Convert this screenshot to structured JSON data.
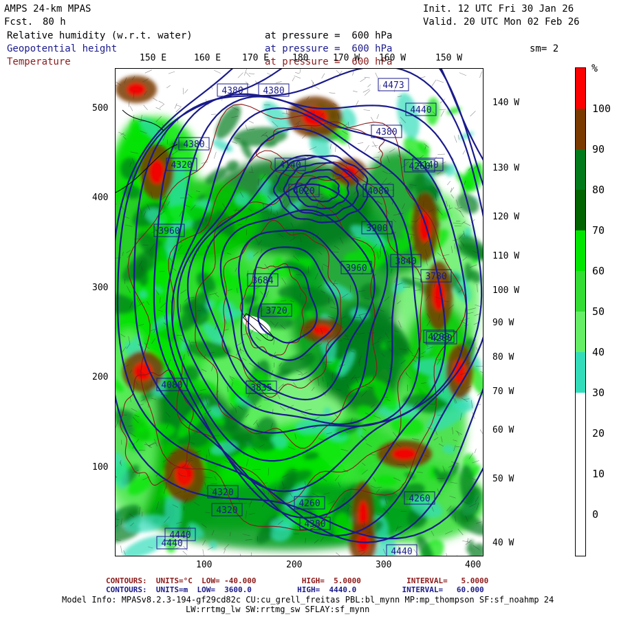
{
  "header": {
    "model": "AMPS 24-km MPAS",
    "fcst_label": "Fcst.",
    "fcst_value": "80 h",
    "init": "Init. 12 UTC Fri 30 Jan 26",
    "valid": "Valid. 20 UTC Mon 02 Feb 26",
    "smoothing": "sm= 2"
  },
  "fields": [
    {
      "name": "Relative humidity (w.r.t. water)",
      "level": "at pressure =  600 hPa",
      "color": "#000000"
    },
    {
      "name": "Geopotential height",
      "level": "at pressure =  600 hPa",
      "color": "#1a1a8c"
    },
    {
      "name": "Temperature",
      "level": "at pressure =  600 hPa",
      "color": "#8b1a1a"
    }
  ],
  "axes": {
    "top_labels": [
      "150 E",
      "160 E",
      "170 E",
      "180",
      "170 W",
      "160 W",
      "150 W"
    ],
    "right_labels": [
      "140 W",
      "130 W",
      "120 W",
      "110 W",
      "100 W",
      "90 W",
      "80 W",
      "70 W",
      "60 W",
      "50 W",
      "40 W"
    ],
    "left_ticks": [
      "500",
      "400",
      "300",
      "200",
      "100"
    ],
    "bottom_ticks": [
      "100",
      "200",
      "300",
      "400"
    ]
  },
  "colorbar": {
    "unit": "%",
    "labels": [
      "100",
      "90",
      "80",
      "70",
      "60",
      "50",
      "40",
      "30",
      "20",
      "10",
      "0"
    ],
    "segments": [
      {
        "range": "90-100+",
        "color": "#ff0000"
      },
      {
        "range": "90-100",
        "color": "#7a3a00"
      },
      {
        "range": "80-90",
        "color": "#007a1a"
      },
      {
        "range": "70-80",
        "color": "#006400"
      },
      {
        "range": "60-70",
        "color": "#00e600"
      },
      {
        "range": "50-60",
        "color": "#33dd33"
      },
      {
        "range": "40-50",
        "color": "#66ee66"
      },
      {
        "range": "30-40",
        "color": "#33ddbb"
      },
      {
        "range": "0-30",
        "color": "#ffffff"
      }
    ]
  },
  "contour_labels": [
    "4380",
    "4380",
    "4473",
    "4440",
    "4380",
    "4380",
    "4320",
    "4260",
    "4140",
    "4080",
    "4020",
    "3960",
    "3900",
    "3840",
    "3780",
    "3720",
    "3684",
    "3835",
    "4200",
    "4320",
    "4440",
    "4260",
    "4380",
    "4440",
    "4200",
    "4140",
    "3960",
    "4080",
    "4260",
    "4320",
    "4440"
  ],
  "footer": {
    "temp_contours": "CONTOURS:  UNITS=°C  LOW= -40.000          HIGH=  5.0000          INTERVAL=   5.0000",
    "height_contours": "CONTOURS:  UNITS=m  LOW=  3600.0          HIGH=  4440.0          INTERVAL=   60.000",
    "model_info": "Model Info: MPASv8.2.3-194-gf29cd82c CU:cu_grell_freitas PBL:bl_mynn MP:mp_thompson SF:sf_noahmp 24",
    "model_info2": "LW:rrtmg_lw SW:rrtmg_sw SFLAY:sf_mynn"
  }
}
